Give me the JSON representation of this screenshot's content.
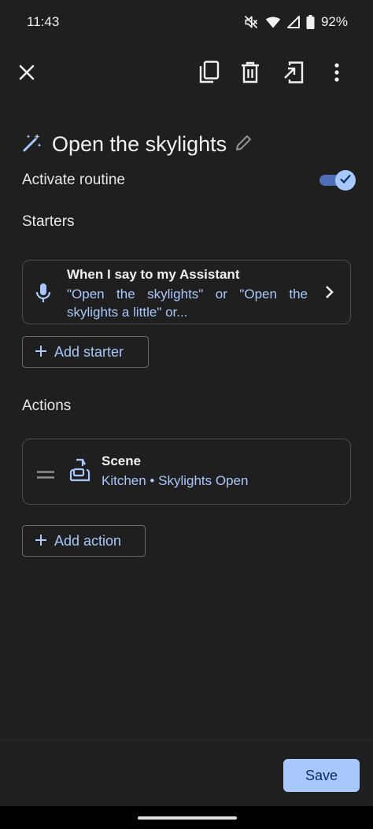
{
  "status_bar": {
    "time": "11:43",
    "battery": "92%",
    "icons": [
      "mute-icon",
      "wifi-icon",
      "signal-icon",
      "battery-icon"
    ]
  },
  "toolbar": {
    "icons": [
      "close-icon",
      "duplicate-icon",
      "delete-icon",
      "add-to-home-icon",
      "more-vert-icon"
    ]
  },
  "routine": {
    "title": "Open the skylights",
    "title_icon": "magic-wand-icon",
    "edit_icon": "edit-pencil-icon",
    "activate_label": "Activate routine",
    "activated": true
  },
  "starters": {
    "section_label": "Starters",
    "items": [
      {
        "icon": "mic-icon",
        "title": "When I say to my Assistant",
        "subtitle": "\"Open the skylights\" or \"Open the skylights a little\" or..."
      }
    ],
    "add_label": "Add starter"
  },
  "actions": {
    "section_label": "Actions",
    "items": [
      {
        "icon": "scene-icon",
        "title": "Scene",
        "subtitle": "Kitchen • Skylights Open"
      }
    ],
    "add_label": "Add action"
  },
  "footer": {
    "save_label": "Save"
  },
  "colors": {
    "background": "#1f1f1f",
    "accent": "#a8c7fa",
    "toggle_track": "#4f6fb8",
    "save_text": "#062e6f"
  }
}
